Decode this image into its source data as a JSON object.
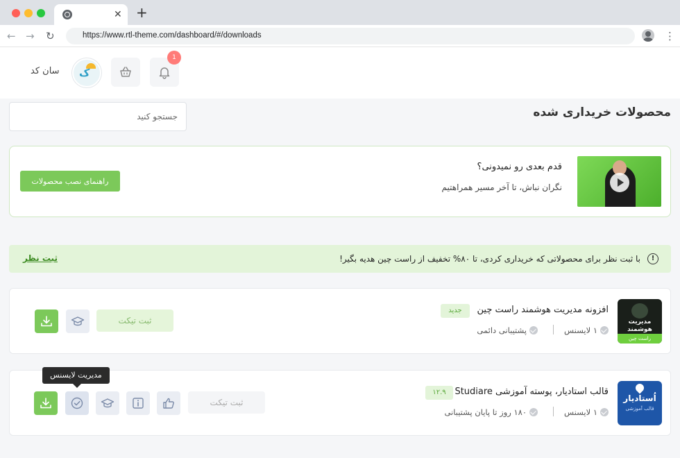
{
  "browser": {
    "url": "https://www.rtl-theme.com/dashboard/#/downloads",
    "tab_close": "✕",
    "new_tab": "+",
    "back": "←",
    "forward": "→",
    "reload": "↻",
    "star": "☆",
    "menu": "⋮"
  },
  "header": {
    "user_name": "سان کد",
    "notification_count": "1",
    "icons": [
      "bell-icon",
      "basket-icon",
      "avatar"
    ]
  },
  "page": {
    "title": "محصولات خریداری شده",
    "search_placeholder": "جستجو کنید"
  },
  "promo": {
    "title": "قدم بعدی رو نمیدونی؟",
    "subtitle": "نگران نباش، تا آخر مسیر همراهتیم",
    "button_label": "راهنمای نصب محصولات"
  },
  "notice": {
    "icon": "!",
    "text": "با ثبت نظر برای محصولاتی که خریداری کردی، تا ۸۰% تخفیف از راست چین هدیه بگیر!",
    "link_label": "ثبت نظر"
  },
  "products": [
    {
      "image_text": "مدیریت هوشمند",
      "image_band": "راست چین",
      "title": "افزونه مدیریت هوشمند راست چین",
      "badge": "جدید",
      "license": "۱ لایسنس",
      "support": "پشتیبانی دائمی",
      "ticket_label": "ثبت تیکت"
    },
    {
      "image_text": "اُستادیار",
      "image_sub": "قالب آموزشی",
      "title": "قالب استادیار، پوسته آموزشی Studiare",
      "badge": "۱۲.۹",
      "license": "۱ لایسنس",
      "support": "۱۸۰ روز تا پایان پشتیبانی",
      "ticket_label": "ثبت تیکت"
    }
  ],
  "tooltip": {
    "text": "مدیریت لایسنس"
  },
  "colors": {
    "accent_green": "#7cc95a",
    "light_green": "#e3f4d9",
    "badge_red": "#ff7b78"
  }
}
